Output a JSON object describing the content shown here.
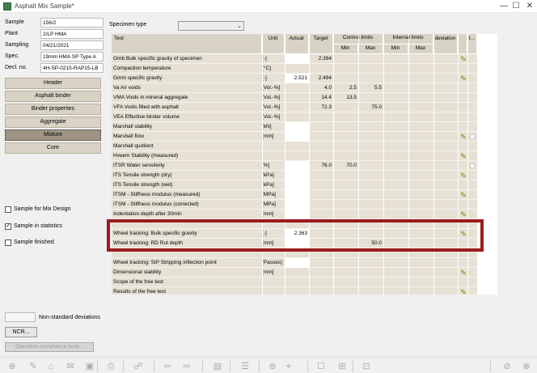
{
  "window": {
    "title": "Asphalt Mix Sample*",
    "minimize": "—",
    "maximize": "☐",
    "close": "✕"
  },
  "fields": [
    {
      "label": "Sample",
      "value": "156/2"
    },
    {
      "label": "Plant",
      "value": "2/LP HMA"
    },
    {
      "label": "Sampling",
      "value": "04/21/2021"
    },
    {
      "label": "Spec.",
      "value": "19mm HMA SP Type A"
    },
    {
      "label": "Decl. no.",
      "value": "4H-SP-0215-RAP15-LB"
    }
  ],
  "nav": [
    "Header",
    "Asphalt binder",
    "Binder properties",
    "Aggregate",
    "Mixture",
    "Core"
  ],
  "nav_active": "Mixture",
  "checks": [
    {
      "label": "Sample for Mix Design",
      "checked": false
    },
    {
      "label": "Sample in statistics",
      "checked": true
    },
    {
      "label": "Sample finished",
      "checked": false
    }
  ],
  "check_mark": "✓",
  "nonstandard_label": "Non-standard deviations",
  "ncr_label": "NCR...",
  "opcomp_label": "Operation compliance level...",
  "specimen_type_label": "Specimen type",
  "specimen_type_arrow": "⌄",
  "headers": {
    "test": "Test",
    "unit": "Unit",
    "actual": "Actual",
    "target": "Target",
    "control": "Control limits",
    "internal": "Internal limits",
    "min": "Min",
    "max": "Max",
    "min2": "Min",
    "max2": "Max",
    "deviation": "deviation",
    "extra": "I..."
  },
  "rows": [
    {
      "test": "Gmb Bulk specific gravity of specimen",
      "unit": "[-]",
      "actual": "",
      "target": "2.394",
      "cmin": "",
      "cmax": "",
      "act_box": true,
      "pencil": true,
      "sbox": false
    },
    {
      "test": "Compaction temperature",
      "unit": "[°C]",
      "actual": "",
      "target": "",
      "cmin": "",
      "cmax": "",
      "act_box": false,
      "pencil": false,
      "sbox": false
    },
    {
      "test": "Gmm specific gravity",
      "unit": "[-]",
      "actual": "2.521",
      "target": "2.494",
      "cmin": "",
      "cmax": "",
      "act_box": true,
      "pencil": true,
      "sbox": false
    },
    {
      "test": "Va Air voids",
      "unit": "[Vol.-%]",
      "actual": "",
      "target": "4.0",
      "cmin": "2.5",
      "cmax": "5.5",
      "act_box": false,
      "pencil": false,
      "sbox": false
    },
    {
      "test": "VMA Voids in mineral aggregate",
      "unit": "[Vol.-%]",
      "actual": "",
      "target": "14.4",
      "cmin": "13.5",
      "cmax": "",
      "act_box": false,
      "pencil": false,
      "sbox": false
    },
    {
      "test": "VFA Voids filled with asphalt",
      "unit": "[Vol.-%]",
      "actual": "",
      "target": "72.3",
      "cmin": "",
      "cmax": "75.0",
      "act_box": false,
      "pencil": false,
      "sbox": false
    },
    {
      "test": "VEA Effective binder volume",
      "unit": "[Vol.-%]",
      "actual": "",
      "target": "",
      "cmin": "",
      "cmax": "",
      "act_box": false,
      "pencil": false,
      "sbox": false
    },
    {
      "test": "Marshall stability",
      "unit": "[kN]",
      "actual": "",
      "target": "",
      "cmin": "",
      "cmax": "",
      "act_box": true,
      "pencil": false,
      "sbox": false
    },
    {
      "test": "Marshall flow",
      "unit": "[mm]",
      "actual": "",
      "target": "",
      "cmin": "",
      "cmax": "",
      "act_box": true,
      "pencil": true,
      "sbox": true
    },
    {
      "test": "Marshall quotient",
      "unit": "",
      "actual": "",
      "target": "",
      "cmin": "",
      "cmax": "",
      "act_box": false,
      "pencil": false,
      "sbox": false
    },
    {
      "test": "Hveem Stability (measured)",
      "unit": "",
      "actual": "",
      "target": "",
      "cmin": "",
      "cmax": "",
      "act_box": false,
      "pencil": true,
      "sbox": false
    },
    {
      "test": "ITSR Water sensitivity",
      "unit": "[%]",
      "actual": "",
      "target": "76.0",
      "cmin": "70.0",
      "cmax": "",
      "act_box": true,
      "pencil": false,
      "sbox": true
    },
    {
      "test": "ITS Tensile strength (dry)",
      "unit": "[kPa]",
      "actual": "",
      "target": "",
      "cmin": "",
      "cmax": "",
      "act_box": true,
      "pencil": true,
      "sbox": false
    },
    {
      "test": "ITS Tensile strength (wet)",
      "unit": "[kPa]",
      "actual": "",
      "target": "",
      "cmin": "",
      "cmax": "",
      "act_box": true,
      "pencil": false,
      "sbox": false
    },
    {
      "test": "ITSM - Stiffness modulus (measured)",
      "unit": "[MPa]",
      "actual": "",
      "target": "",
      "cmin": "",
      "cmax": "",
      "act_box": true,
      "pencil": true,
      "sbox": false
    },
    {
      "test": "ITSM - Stiffness modulus (corrected)",
      "unit": "[MPa]",
      "actual": "",
      "target": "",
      "cmin": "",
      "cmax": "",
      "act_box": true,
      "pencil": false,
      "sbox": false
    },
    {
      "test": "Indentation depth after 30min",
      "unit": "[mm]",
      "actual": "",
      "target": "",
      "cmin": "",
      "cmax": "",
      "act_box": true,
      "pencil": true,
      "sbox": false
    },
    {
      "test": "",
      "unit": "",
      "actual": "",
      "target": "",
      "cmin": "",
      "cmax": "",
      "act_box": false,
      "pencil": false,
      "sbox": false
    },
    {
      "test": "Wheel tracking: Bulk specific gravity",
      "unit": "[-]",
      "actual": "2.363",
      "target": "",
      "cmin": "",
      "cmax": "",
      "act_box": true,
      "pencil": true,
      "sbox": false
    },
    {
      "test": "Wheel tracking: RD Rut depth",
      "unit": "[mm]",
      "actual": "",
      "target": "",
      "cmin": "",
      "cmax": "50.0",
      "act_box": true,
      "pencil": false,
      "sbox": false
    },
    {
      "test": "",
      "unit": "",
      "actual": "",
      "target": "",
      "cmin": "",
      "cmax": "",
      "act_box": false,
      "pencil": false,
      "sbox": false
    },
    {
      "test": "Wheel tracking: SIP Stripping inflection point",
      "unit": "[Passes]",
      "actual": "",
      "target": "",
      "cmin": "",
      "cmax": "",
      "act_box": true,
      "pencil": false,
      "sbox": false
    },
    {
      "test": "Dimensional stability",
      "unit": "[mm]",
      "actual": "",
      "target": "",
      "cmin": "",
      "cmax": "",
      "act_box": false,
      "pencil": true,
      "sbox": false
    },
    {
      "test": "Scope of the free test",
      "unit": "",
      "actual": "",
      "target": "",
      "cmin": "",
      "cmax": "",
      "act_box": false,
      "pencil": false,
      "sbox": false
    },
    {
      "test": "Results of the free test",
      "unit": "",
      "actual": "",
      "target": "",
      "cmin": "",
      "cmax": "",
      "act_box": false,
      "pencil": true,
      "sbox": false
    }
  ],
  "pencil_glyph": "✎",
  "tools": [
    "⊕",
    "✎",
    "⌂",
    "✉",
    "▣",
    "⎙",
    "☍",
    "⇦",
    "⇨",
    "▤",
    "☰",
    "⊛",
    "⌖",
    "☐",
    "⊞",
    "⊡",
    "⊘",
    "⊗"
  ]
}
